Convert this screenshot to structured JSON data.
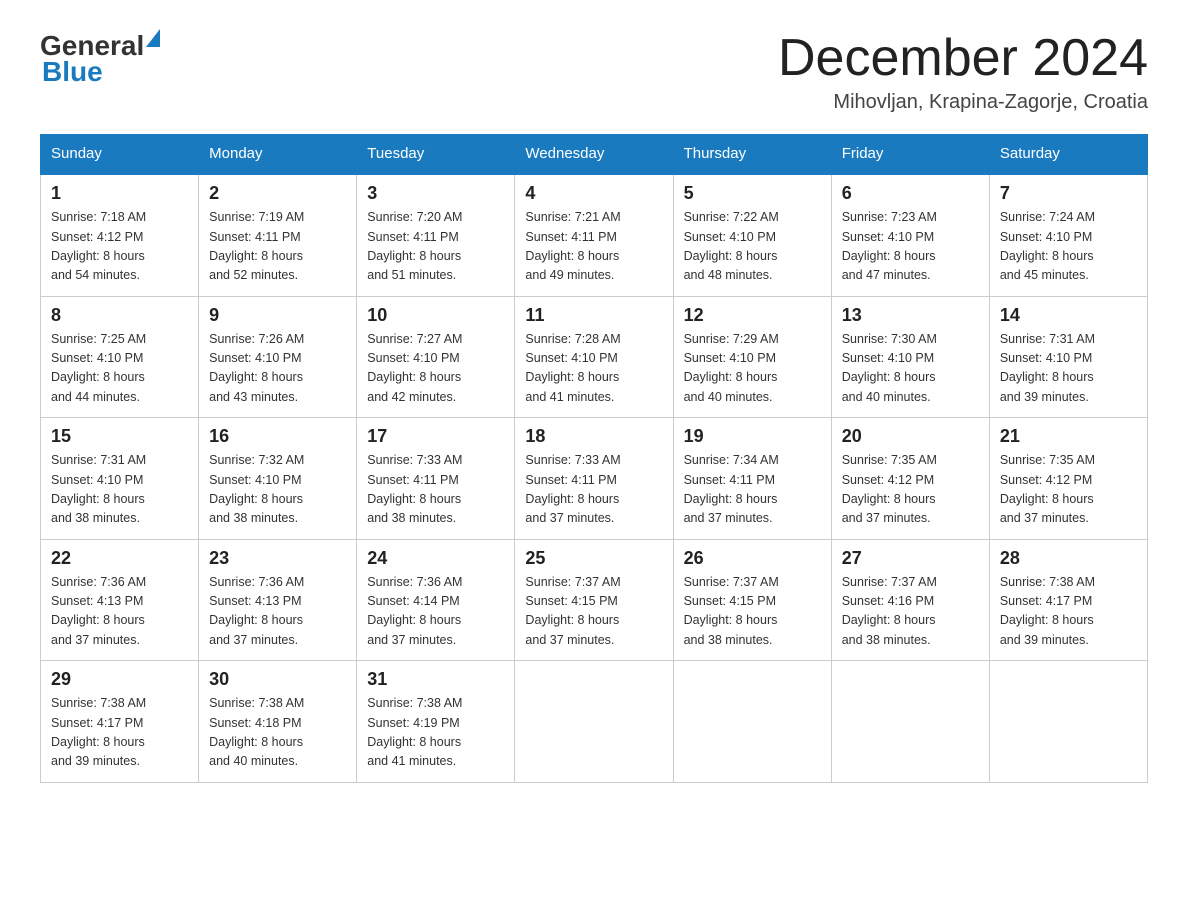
{
  "header": {
    "logo_general": "General",
    "logo_blue": "Blue",
    "month_title": "December 2024",
    "location": "Mihovljan, Krapina-Zagorje, Croatia"
  },
  "days_of_week": [
    "Sunday",
    "Monday",
    "Tuesday",
    "Wednesday",
    "Thursday",
    "Friday",
    "Saturday"
  ],
  "weeks": [
    [
      {
        "day": "1",
        "sunrise": "7:18 AM",
        "sunset": "4:12 PM",
        "daylight": "8 hours and 54 minutes."
      },
      {
        "day": "2",
        "sunrise": "7:19 AM",
        "sunset": "4:11 PM",
        "daylight": "8 hours and 52 minutes."
      },
      {
        "day": "3",
        "sunrise": "7:20 AM",
        "sunset": "4:11 PM",
        "daylight": "8 hours and 51 minutes."
      },
      {
        "day": "4",
        "sunrise": "7:21 AM",
        "sunset": "4:11 PM",
        "daylight": "8 hours and 49 minutes."
      },
      {
        "day": "5",
        "sunrise": "7:22 AM",
        "sunset": "4:10 PM",
        "daylight": "8 hours and 48 minutes."
      },
      {
        "day": "6",
        "sunrise": "7:23 AM",
        "sunset": "4:10 PM",
        "daylight": "8 hours and 47 minutes."
      },
      {
        "day": "7",
        "sunrise": "7:24 AM",
        "sunset": "4:10 PM",
        "daylight": "8 hours and 45 minutes."
      }
    ],
    [
      {
        "day": "8",
        "sunrise": "7:25 AM",
        "sunset": "4:10 PM",
        "daylight": "8 hours and 44 minutes."
      },
      {
        "day": "9",
        "sunrise": "7:26 AM",
        "sunset": "4:10 PM",
        "daylight": "8 hours and 43 minutes."
      },
      {
        "day": "10",
        "sunrise": "7:27 AM",
        "sunset": "4:10 PM",
        "daylight": "8 hours and 42 minutes."
      },
      {
        "day": "11",
        "sunrise": "7:28 AM",
        "sunset": "4:10 PM",
        "daylight": "8 hours and 41 minutes."
      },
      {
        "day": "12",
        "sunrise": "7:29 AM",
        "sunset": "4:10 PM",
        "daylight": "8 hours and 40 minutes."
      },
      {
        "day": "13",
        "sunrise": "7:30 AM",
        "sunset": "4:10 PM",
        "daylight": "8 hours and 40 minutes."
      },
      {
        "day": "14",
        "sunrise": "7:31 AM",
        "sunset": "4:10 PM",
        "daylight": "8 hours and 39 minutes."
      }
    ],
    [
      {
        "day": "15",
        "sunrise": "7:31 AM",
        "sunset": "4:10 PM",
        "daylight": "8 hours and 38 minutes."
      },
      {
        "day": "16",
        "sunrise": "7:32 AM",
        "sunset": "4:10 PM",
        "daylight": "8 hours and 38 minutes."
      },
      {
        "day": "17",
        "sunrise": "7:33 AM",
        "sunset": "4:11 PM",
        "daylight": "8 hours and 38 minutes."
      },
      {
        "day": "18",
        "sunrise": "7:33 AM",
        "sunset": "4:11 PM",
        "daylight": "8 hours and 37 minutes."
      },
      {
        "day": "19",
        "sunrise": "7:34 AM",
        "sunset": "4:11 PM",
        "daylight": "8 hours and 37 minutes."
      },
      {
        "day": "20",
        "sunrise": "7:35 AM",
        "sunset": "4:12 PM",
        "daylight": "8 hours and 37 minutes."
      },
      {
        "day": "21",
        "sunrise": "7:35 AM",
        "sunset": "4:12 PM",
        "daylight": "8 hours and 37 minutes."
      }
    ],
    [
      {
        "day": "22",
        "sunrise": "7:36 AM",
        "sunset": "4:13 PM",
        "daylight": "8 hours and 37 minutes."
      },
      {
        "day": "23",
        "sunrise": "7:36 AM",
        "sunset": "4:13 PM",
        "daylight": "8 hours and 37 minutes."
      },
      {
        "day": "24",
        "sunrise": "7:36 AM",
        "sunset": "4:14 PM",
        "daylight": "8 hours and 37 minutes."
      },
      {
        "day": "25",
        "sunrise": "7:37 AM",
        "sunset": "4:15 PM",
        "daylight": "8 hours and 37 minutes."
      },
      {
        "day": "26",
        "sunrise": "7:37 AM",
        "sunset": "4:15 PM",
        "daylight": "8 hours and 38 minutes."
      },
      {
        "day": "27",
        "sunrise": "7:37 AM",
        "sunset": "4:16 PM",
        "daylight": "8 hours and 38 minutes."
      },
      {
        "day": "28",
        "sunrise": "7:38 AM",
        "sunset": "4:17 PM",
        "daylight": "8 hours and 39 minutes."
      }
    ],
    [
      {
        "day": "29",
        "sunrise": "7:38 AM",
        "sunset": "4:17 PM",
        "daylight": "8 hours and 39 minutes."
      },
      {
        "day": "30",
        "sunrise": "7:38 AM",
        "sunset": "4:18 PM",
        "daylight": "8 hours and 40 minutes."
      },
      {
        "day": "31",
        "sunrise": "7:38 AM",
        "sunset": "4:19 PM",
        "daylight": "8 hours and 41 minutes."
      },
      null,
      null,
      null,
      null
    ]
  ],
  "labels": {
    "sunrise_prefix": "Sunrise: ",
    "sunset_prefix": "Sunset: ",
    "daylight_prefix": "Daylight: "
  }
}
